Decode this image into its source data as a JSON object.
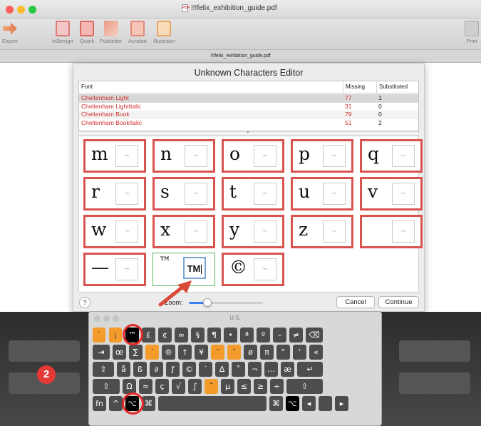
{
  "window": {
    "title": "!!!felix_exhibition_guide.pdf",
    "tab": "!!!felix_exhibition_guide.pdf"
  },
  "toolbar": {
    "export": "Export",
    "indesign": "InDesign",
    "quark": "Quark",
    "publisher": "Publisher",
    "acrobat": "Acrobat",
    "illustrator": "Illustrator",
    "print": "Print"
  },
  "dialog": {
    "title": "Unknown Characters Editor",
    "columns": {
      "font": "Font",
      "missing": "Missing",
      "substituted": "Substituted"
    },
    "fonts": [
      {
        "name": "Cheltenham Light",
        "missing": "77",
        "substituted": "1"
      },
      {
        "name": "Cheltenham LightItalic",
        "missing": "31",
        "substituted": "0"
      },
      {
        "name": "Cheltenham Book",
        "missing": "79",
        "substituted": "0"
      },
      {
        "name": "Cheltenham BookItalic",
        "missing": "51",
        "substituted": "2"
      }
    ],
    "chars": [
      {
        "ch": "m",
        "sub": "~"
      },
      {
        "ch": "n",
        "sub": "~"
      },
      {
        "ch": "o",
        "sub": "~"
      },
      {
        "ch": "p",
        "sub": "~"
      },
      {
        "ch": "q",
        "sub": "~"
      },
      {
        "ch": "r",
        "sub": "~"
      },
      {
        "ch": "s",
        "sub": "~"
      },
      {
        "ch": "t",
        "sub": "~"
      },
      {
        "ch": "u",
        "sub": "~"
      },
      {
        "ch": "v",
        "sub": "~"
      },
      {
        "ch": "w",
        "sub": "~"
      },
      {
        "ch": "x",
        "sub": "~"
      },
      {
        "ch": "y",
        "sub": "~"
      },
      {
        "ch": "z",
        "sub": "~"
      },
      {
        "ch": "",
        "sub": "~"
      },
      {
        "ch": "—",
        "sub": "~"
      },
      {
        "ch": "™",
        "sub": "TM"
      },
      {
        "ch": "©",
        "sub": "~"
      }
    ],
    "help": "?",
    "zoom_label": "Zoom:",
    "zoom_level": 0.25,
    "cancel": "Cancel",
    "continue": "Continue"
  },
  "step_badge": "2",
  "keyboard": {
    "title": "U.S.",
    "rows": [
      [
        "`",
        "¡",
        "™",
        "£",
        "¢",
        "∞",
        "§",
        "¶",
        "•",
        "ª",
        "º",
        "–",
        "≠",
        "⌫"
      ],
      [
        "⇥",
        "œ",
        "∑",
        "´",
        "®",
        "†",
        "¥",
        "¨",
        "ˆ",
        "ø",
        "π",
        "“",
        "‘",
        "«"
      ],
      [
        "⇪",
        "å",
        "ß",
        "∂",
        "ƒ",
        "©",
        "˙",
        "∆",
        "˚",
        "¬",
        "…",
        "æ",
        "↵"
      ],
      [
        "⇧",
        "Ω",
        "≈",
        "ç",
        "√",
        "∫",
        "˜",
        "µ",
        "≤",
        "≥",
        "÷",
        "⇧"
      ],
      [
        "fn",
        "^",
        "⌥",
        "⌘",
        "",
        "⌘",
        "⌥",
        "◂",
        "",
        "▸"
      ]
    ]
  },
  "colors": {
    "accent": "#d9534f",
    "missing_text": "#d0312d",
    "highlight": "#f39c2b",
    "badge": "#e53935"
  }
}
